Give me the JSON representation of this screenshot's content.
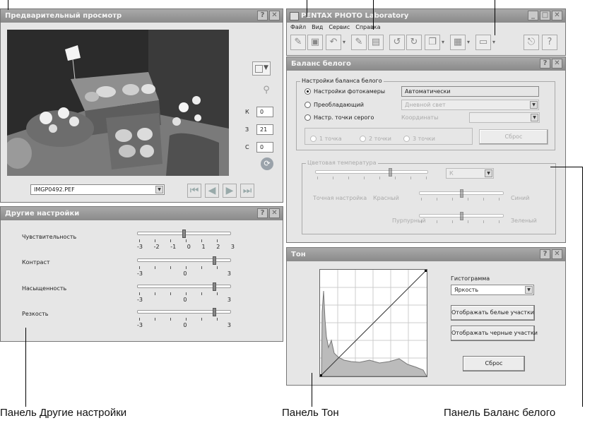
{
  "preview": {
    "title": "Предварительный просмотр",
    "file": "IMGP0492.PEF",
    "k_label": "К",
    "k_value": "0",
    "z_label": "З",
    "z_value": "21",
    "c_label": "С",
    "c_value": "0"
  },
  "main": {
    "title": "PENTAX PHOTO Laboratory",
    "menu": [
      "Файл",
      "Вид",
      "Сервис",
      "Справка"
    ]
  },
  "wb": {
    "title": "Баланс белого",
    "group_title": "Настройки баланса белого",
    "opt_camera": "Настройки фотокамеры",
    "opt_camera_value": "Автоматически",
    "opt_dominant": "Преобладающий",
    "opt_dominant_value": "Дневной свет",
    "opt_gray": "Настр. точки серого",
    "coords_label": "Координаты",
    "btn_1": "1 точка",
    "btn_2": "2 точки",
    "btn_3": "3 точки",
    "reset": "Сброс",
    "ct_title": "Цветовая температура",
    "ct_value": "К",
    "fine_label": "Точная настройка",
    "red": "Красный",
    "blue": "Синий",
    "magenta": "Пурпурный",
    "green": "Зеленый"
  },
  "other": {
    "title": "Другие настройки",
    "sensitivity": "Чувствительность",
    "scale7": [
      "-3",
      "-2",
      "-1",
      "0",
      "1",
      "2",
      "3"
    ],
    "contrast": "Контраст",
    "saturation": "Насыщенность",
    "sharpness": "Резкость",
    "scale3": [
      "-3",
      "0",
      "3"
    ],
    "levels": {
      "sensitivity": 0,
      "contrast": 2,
      "saturation": 2,
      "sharpness": 2
    }
  },
  "tone": {
    "title": "Тон",
    "hist_label": "Гистограмма",
    "hist_value": "Яркость",
    "show_white": "Отображать белые участки",
    "show_black": "Отображать черные участки",
    "reset": "Сброс"
  },
  "captions": {
    "other": "Панель Другие настройки",
    "tone": "Панель Тон",
    "wb": "Панель Баланс белого"
  }
}
